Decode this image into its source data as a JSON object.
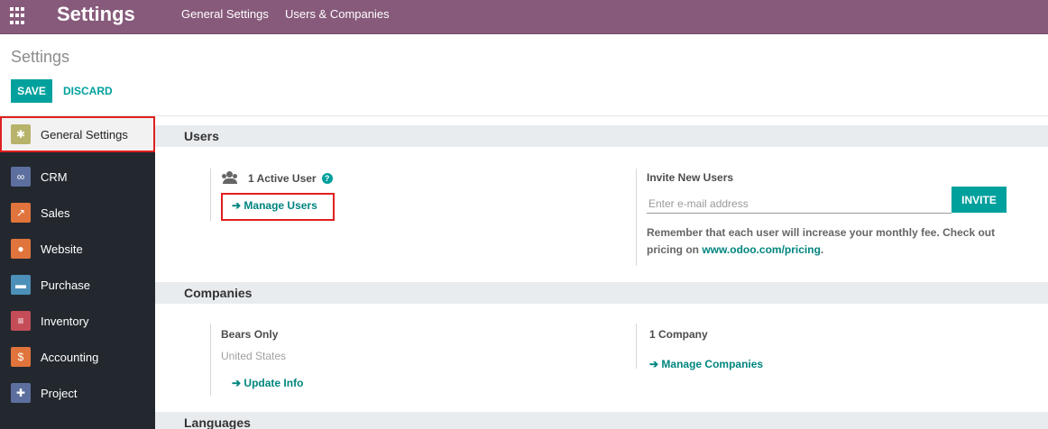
{
  "navbar": {
    "icon": "apps-grid-icon",
    "brand": "Settings",
    "menu": [
      "General Settings",
      "Users & Companies"
    ]
  },
  "control_panel": {
    "title": "Settings",
    "save_label": "SAVE",
    "discard_label": "DISCARD"
  },
  "sidebar": {
    "items": [
      {
        "label": "General Settings",
        "icon": "gear-icon",
        "color": "#b7b36a",
        "active": true
      },
      {
        "label": "CRM",
        "icon": "handshake-icon",
        "color": "#5c6f9e"
      },
      {
        "label": "Sales",
        "icon": "chart-up-icon",
        "color": "#e0743c"
      },
      {
        "label": "Website",
        "icon": "globe-icon",
        "color": "#e0743c"
      },
      {
        "label": "Purchase",
        "icon": "credit-card-icon",
        "color": "#4c8fb8"
      },
      {
        "label": "Inventory",
        "icon": "boxes-icon",
        "color": "#c44d58"
      },
      {
        "label": "Accounting",
        "icon": "dollar-doc-icon",
        "color": "#e0743c"
      },
      {
        "label": "Project",
        "icon": "puzzle-icon",
        "color": "#5c6f9e"
      }
    ]
  },
  "users": {
    "heading": "Users",
    "active_users": "1 Active User",
    "manage_users": "Manage Users",
    "invite_title": "Invite New Users",
    "invite_placeholder": "Enter e-mail address",
    "invite_button": "INVITE",
    "note_text": "Remember that each user will increase your monthly fee. Check out pricing on",
    "pricing_link": "www.odoo.com/pricing"
  },
  "companies": {
    "heading": "Companies",
    "company_name": "Bears Only",
    "company_country": "United States",
    "update_info": "Update Info",
    "company_count": "1 Company",
    "manage_companies": "Manage Companies"
  },
  "languages": {
    "heading": "Languages"
  },
  "colors": {
    "navbar": "#875a7b",
    "accent": "#00a09d",
    "sidebar": "#23282e",
    "highlight": "#e01f1f"
  }
}
